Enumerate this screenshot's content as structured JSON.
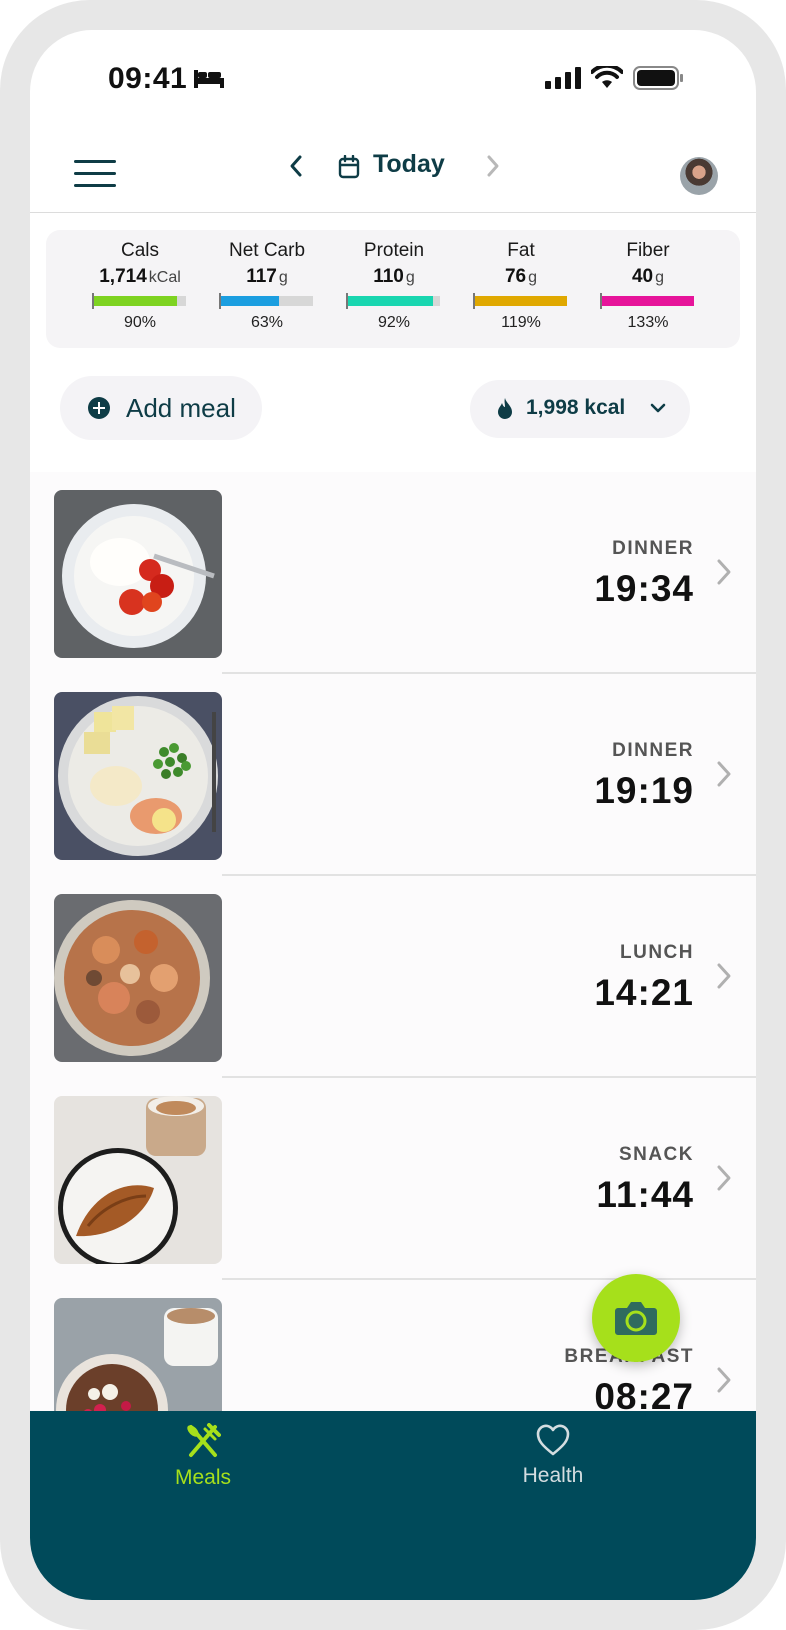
{
  "status_bar": {
    "time": "09:41"
  },
  "header": {
    "date_label": "Today"
  },
  "macros": [
    {
      "name": "Cals",
      "value": "1,714",
      "unit": "kCal",
      "percent_label": "90%",
      "fill": 0.9,
      "color": "#7ed321"
    },
    {
      "name": "Net Carb",
      "value": "117",
      "unit": "g",
      "percent_label": "63%",
      "fill": 0.63,
      "color": "#1b9ee0"
    },
    {
      "name": "Protein",
      "value": "110",
      "unit": "g",
      "percent_label": "92%",
      "fill": 0.92,
      "color": "#19d6b0"
    },
    {
      "name": "Fat",
      "value": "76",
      "unit": "g",
      "percent_label": "119%",
      "fill": 1.0,
      "color": "#e0a800"
    },
    {
      "name": "Fiber",
      "value": "40",
      "unit": "g",
      "percent_label": "133%",
      "fill": 1.0,
      "color": "#e6149a"
    }
  ],
  "actions": {
    "add_meal_label": "Add meal",
    "kcal_target_label": "1,998 kcal"
  },
  "meals": [
    {
      "type": "DINNER",
      "time": "19:34",
      "photo": "yogurt-strawberries"
    },
    {
      "type": "DINNER",
      "time": "19:19",
      "photo": "salmon-potatoes-peas"
    },
    {
      "type": "LUNCH",
      "time": "14:21",
      "photo": "stew-bowl"
    },
    {
      "type": "SNACK",
      "time": "11:44",
      "photo": "croissant-coffee"
    },
    {
      "type": "BREAKFAST",
      "time": "08:27",
      "photo": "granola-berries-coffee"
    }
  ],
  "tabs": {
    "meals_label": "Meals",
    "health_label": "Health"
  },
  "colors": {
    "accent_green": "#a6e01b",
    "tabbar": "#004a5a",
    "primary_text": "#0e3c46"
  }
}
